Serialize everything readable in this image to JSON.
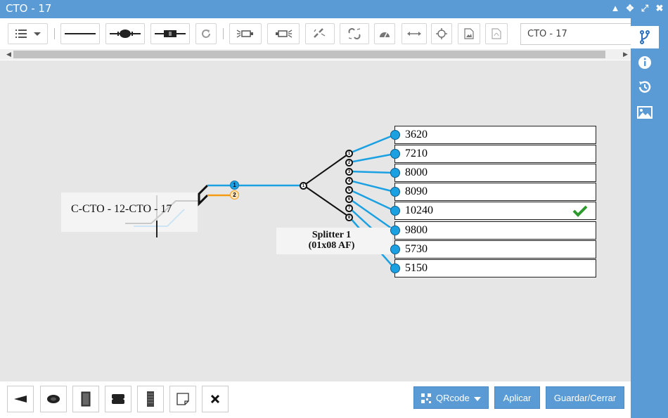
{
  "window": {
    "title": "CTO - 17"
  },
  "toolbar": {
    "search_value": "CTO - 17"
  },
  "diagram": {
    "cable_label": "C-CTO - 12-CTO - 17",
    "splitter_name": "Splitter 1",
    "splitter_type": "(01x08 AF)",
    "splitter_input_port": "1",
    "fiber_ports": [
      "1",
      "2"
    ],
    "outputs": [
      {
        "port": "1",
        "value": "3620",
        "checked": false
      },
      {
        "port": "2",
        "value": "7210",
        "checked": false
      },
      {
        "port": "3",
        "value": "8000",
        "checked": false
      },
      {
        "port": "4",
        "value": "8090",
        "checked": false
      },
      {
        "port": "5",
        "value": "10240",
        "checked": true
      },
      {
        "port": "6",
        "value": "9800",
        "checked": false
      },
      {
        "port": "7",
        "value": "5730",
        "checked": false
      },
      {
        "port": "8",
        "value": "5150",
        "checked": false
      }
    ],
    "colors": {
      "fiber_blue": "#1ba1e2",
      "fiber_orange": "#f39c12",
      "check_green": "#2e9a2e"
    }
  },
  "footer": {
    "qrcode_label": "QRcode",
    "apply_label": "Aplicar",
    "save_close_label": "Guardar/Cerrar"
  },
  "theme": {
    "accent": "#5b9bd5"
  }
}
